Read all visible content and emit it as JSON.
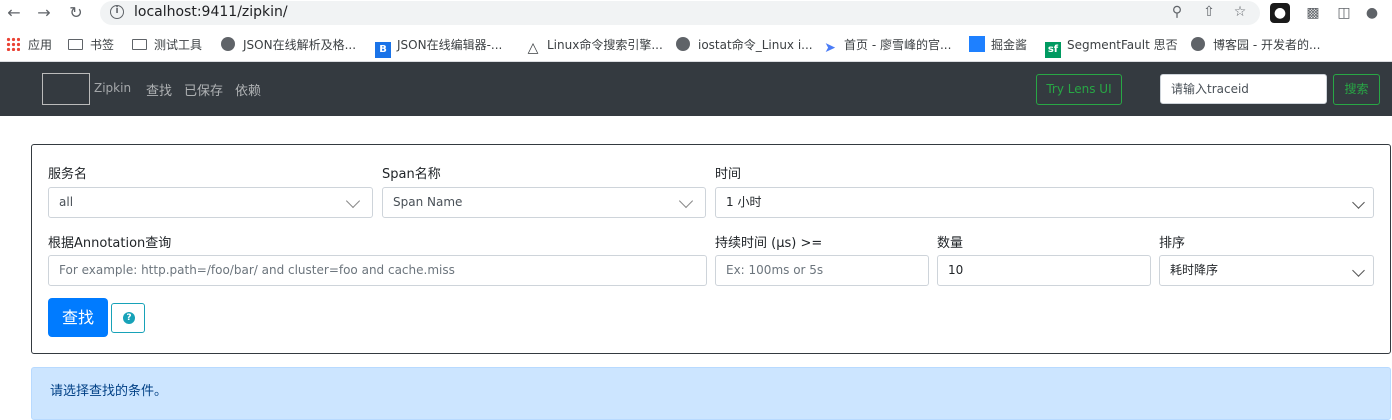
{
  "browser": {
    "url": "localhost:9411/zipkin/",
    "bookmarks": [
      {
        "label": "应用",
        "icon": "apps-grid-icon"
      },
      {
        "label": "书签",
        "icon": "folder-icon"
      },
      {
        "label": "测试工具",
        "icon": "folder-icon"
      },
      {
        "label": "JSON在线解析及格...",
        "icon": "globe-icon"
      },
      {
        "label": "JSON在线编辑器-...",
        "icon": "bejson-icon"
      },
      {
        "label": "Linux命令搜索引擎...",
        "icon": "penguin-icon"
      },
      {
        "label": "iostat命令_Linux i...",
        "icon": "globe-icon"
      },
      {
        "label": "首页 - 廖雪峰的官...",
        "icon": "rocket-icon"
      },
      {
        "label": "掘金酱",
        "icon": "juejin-icon"
      },
      {
        "label": "SegmentFault 思否",
        "icon": "segmentfault-icon"
      },
      {
        "label": "博客园 - 开发者的...",
        "icon": "globe-icon"
      }
    ]
  },
  "navbar": {
    "brand": "Zipkin",
    "links": [
      "查找",
      "已保存",
      "依赖"
    ],
    "lens_button": "Try Lens UI",
    "traceid_placeholder": "请输入traceid",
    "search_button": "搜索"
  },
  "form": {
    "service_label": "服务名",
    "service_value": "all",
    "span_label": "Span名称",
    "span_placeholder": "Span Name",
    "time_label": "时间",
    "time_value": "1 小时",
    "annotation_label": "根据Annotation查询",
    "annotation_placeholder": "For example: http.path=/foo/bar/ and cluster=foo and cache.miss",
    "duration_label": "持续时间 (μs) >=",
    "duration_placeholder": "Ex: 100ms or 5s",
    "limit_label": "数量",
    "limit_value": "10",
    "sort_label": "排序",
    "sort_value": "耗时降序",
    "find_button": "查找",
    "help_symbol": "?"
  },
  "alert_text": "请选择查找的条件。",
  "colors": {
    "navbar": "#343a40",
    "primary": "#007bff",
    "success": "#28a745",
    "info": "#17a2b8",
    "alert_bg": "#cce5ff"
  }
}
